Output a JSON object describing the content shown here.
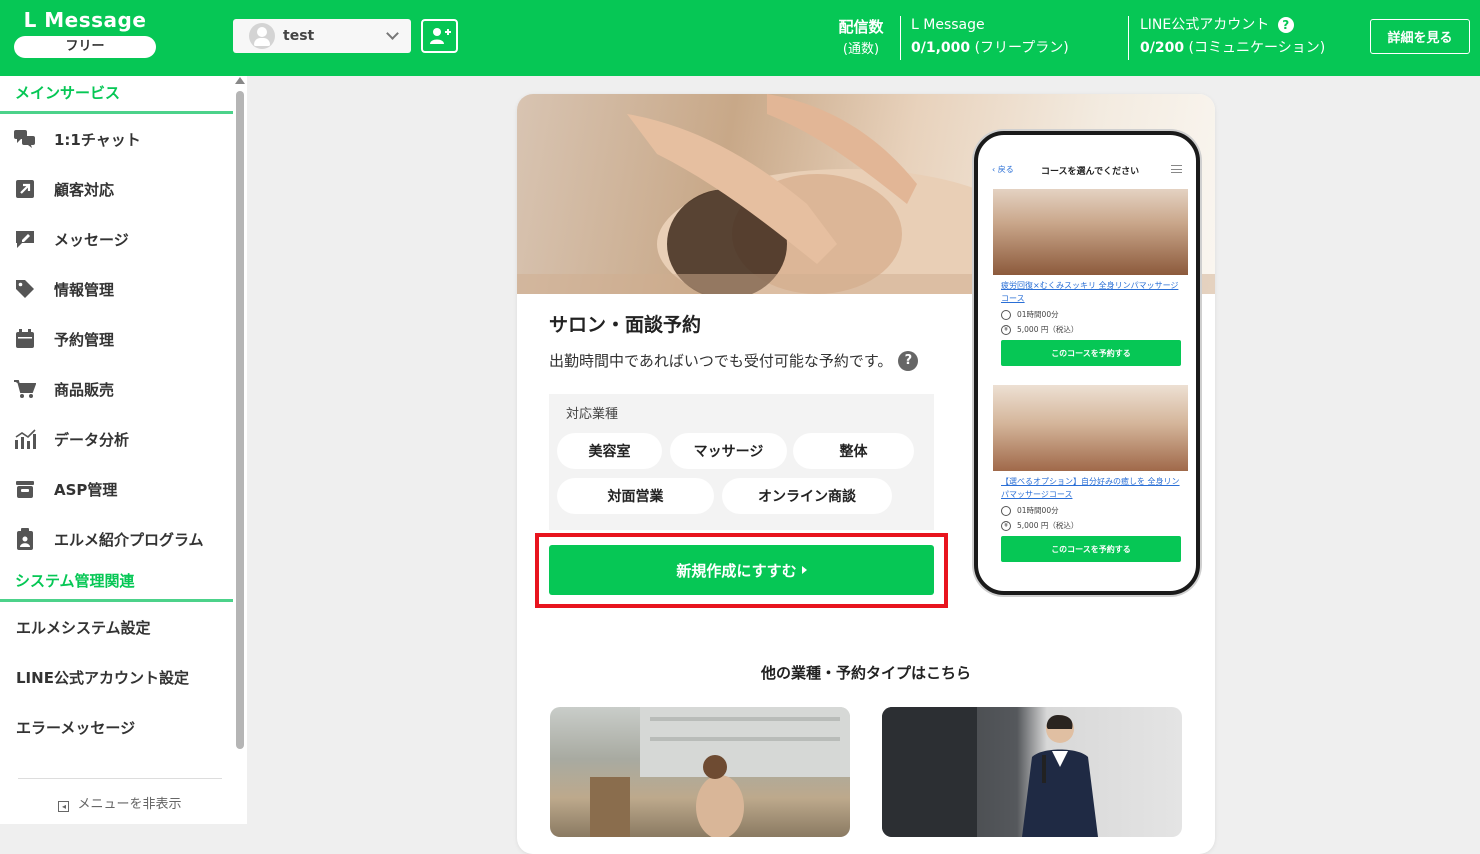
{
  "header": {
    "logo": "L Message",
    "plan_badge": "フリー",
    "account": {
      "name": "test"
    },
    "delivery": {
      "label": "配信数",
      "sublabel": "(通数)",
      "lmessage_title": "L Message",
      "lmessage_count": "0/1,000",
      "lmessage_plan": "(フリープラン)",
      "line_title": "LINE公式アカウント",
      "line_count": "0/200",
      "line_plan": "(コミュニケーション)"
    },
    "details_button": "詳細を見る",
    "accent_color": "#06c755"
  },
  "sidebar": {
    "main_heading": "メインサービス",
    "items": [
      {
        "label": "1:1チャット",
        "icon": "chat-icon"
      },
      {
        "label": "顧客対応",
        "icon": "arrow-box-icon"
      },
      {
        "label": "メッセージ",
        "icon": "message-edit-icon"
      },
      {
        "label": "情報管理",
        "icon": "tag-icon"
      },
      {
        "label": "予約管理",
        "icon": "calendar-icon"
      },
      {
        "label": "商品販売",
        "icon": "cart-icon"
      },
      {
        "label": "データ分析",
        "icon": "chart-icon"
      },
      {
        "label": "ASP管理",
        "icon": "asp-icon"
      },
      {
        "label": "エルメ紹介プログラム",
        "icon": "clipboard-icon"
      }
    ],
    "system_heading": "システム管理関連",
    "system_items": [
      {
        "label": "エルメシステム設定"
      },
      {
        "label": "LINE公式アカウント設定"
      },
      {
        "label": "エラーメッセージ"
      }
    ],
    "hide_menu": "メニューを非表示"
  },
  "card": {
    "title": "サロン・面談予約",
    "description": "出勤時間中であればいつでも受付可能な予約です。",
    "industries_label": "対応業種",
    "industries": [
      "美容室",
      "マッサージ",
      "整体",
      "対面営業",
      "オンライン商談"
    ],
    "cta": "新規作成にすすむ",
    "other_title": "他の業種・予約タイプはこちら"
  },
  "phone": {
    "back": "戻る",
    "title": "コースを選んでください",
    "courses": [
      {
        "name": "疲労回復×むくみスッキリ 全身リンパマッサージコース",
        "duration": "01時間00分",
        "price": "5,000 円（税込）",
        "button": "このコースを予約する"
      },
      {
        "name": "【選べるオプション】自分好みの癒しを 全身リンパマッサージコース",
        "duration": "01時間00分",
        "price": "5,000 円（税込）",
        "button": "このコースを予約する"
      }
    ]
  }
}
